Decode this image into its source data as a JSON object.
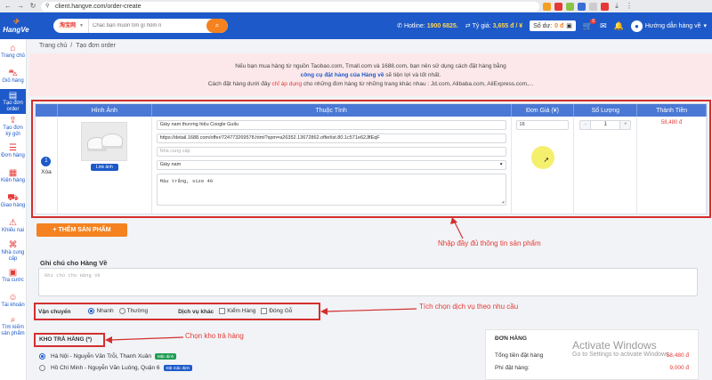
{
  "browser": {
    "url": "client.hangve.com/order-create"
  },
  "header": {
    "logo": "HangVe",
    "search_source": "淘宝网",
    "search_placeholder": "Chắc bạn muốn tìm gì hôm n",
    "hotline_label": "Hotline:",
    "hotline_value": "1900 6825.",
    "rate_label": "Tỷ giá:",
    "rate_value": "3,655 đ / ¥",
    "balance_label": "Số dư:",
    "balance_value": "0 đ",
    "cart_count": "0",
    "user_name": "Hướng dẫn hàng về"
  },
  "sidebar": {
    "items": [
      {
        "label": "Trang chủ"
      },
      {
        "label": "Giỏ hàng"
      },
      {
        "label": "Tạo đơn order"
      },
      {
        "label": "Tạo đơn ký gửi"
      },
      {
        "label": "Đơn hàng"
      },
      {
        "label": "Kiện hàng"
      },
      {
        "label": "Giao hàng"
      },
      {
        "label": "Khiếu nại"
      },
      {
        "label": "Nhà cung cấp"
      },
      {
        "label": "Tra cước"
      },
      {
        "label": "Tài khoản"
      },
      {
        "label": "Tìm kiếm sản phẩm"
      }
    ]
  },
  "breadcrumb": {
    "home": "Trang chủ",
    "sep": "/",
    "current": "Tạo đơn order"
  },
  "notice": {
    "line1": "Nếu bạn mua hàng từ nguồn Taobao.com, Tmall.com và 1688.com, bạn nên sử dụng cách đặt hàng bằng",
    "line2_link": "công cụ đặt hàng của Hàng về",
    "line2_rest": " sẽ tiện lợi và tốt nhất.",
    "line3_pre": "Cách đặt hàng dưới đây ",
    "line3_red": "chỉ áp dụng",
    "line3_post": " cho những đơn hàng từ những trang khác nhau : Jd.com, Alibaba.com, AliExpress.com,..."
  },
  "table": {
    "headers": [
      "Hình Ảnh",
      "Thuộc Tính",
      "Đơn Giá (¥)",
      "Số Lượng",
      "Thành Tiền"
    ],
    "row": {
      "index": "1",
      "delete_label": "Xóa",
      "link_img_label": "Link ảnh",
      "product_name": "Giày nam thương hiệu Coogle Guilu",
      "product_link": "https://detail.1688.com/offer/724773269578.html?spm=a26352.13672862.offerlist.80.1c571e62JlfEqF",
      "supplier_placeholder": "Nhà cung cấp",
      "category": "Giày nam",
      "note": "Màu trắng, size 40",
      "price": "16",
      "qty_minus": "-",
      "qty": "1",
      "qty_plus": "+",
      "total": "58,480 đ"
    }
  },
  "add_product_label": "+ THÊM SẢN PHẨM",
  "annotations": {
    "product": "Nhập đầy đủ thông tin sản phẩm",
    "service": "Tích chọn dịch vụ theo nhu cầu",
    "warehouse": "Chọn kho trả hàng"
  },
  "note": {
    "label": "Ghi chú cho Hàng Về",
    "placeholder": "Ghi chú cho Hàng Về"
  },
  "shipping": {
    "label": "Vận chuyển",
    "options": [
      {
        "label": "Nhanh",
        "selected": true
      },
      {
        "label": "Thường",
        "selected": false
      }
    ],
    "extra_label": "Dịch vụ khác",
    "extras": [
      {
        "label": "Kiểm Hàng"
      },
      {
        "label": "Đóng Gỗ"
      }
    ]
  },
  "warehouse": {
    "label": "KHO TRẢ HÀNG (*)",
    "items": [
      {
        "name": "Hà Nội - Nguyễn Văn Trỗi, Thanh Xuân",
        "badge": "Mặc định"
      },
      {
        "name": "Hồ Chí Minh - Nguyễn Văn Luông, Quận 6",
        "badge": "Đặt mặc định"
      }
    ]
  },
  "order": {
    "title": "ĐƠN HÀNG",
    "lines": [
      {
        "label": "Tổng tiền đặt hàng",
        "value": "58,480 đ"
      },
      {
        "label": "Phí đặt hàng:",
        "value": "9,000 đ"
      }
    ]
  },
  "watermark": {
    "title": "Activate Windows",
    "subtitle": "Go to Settings to activate Windows."
  },
  "colors": {
    "brand": "#1d59c9",
    "accent": "#f58220",
    "annotation": "#d32f2f"
  }
}
